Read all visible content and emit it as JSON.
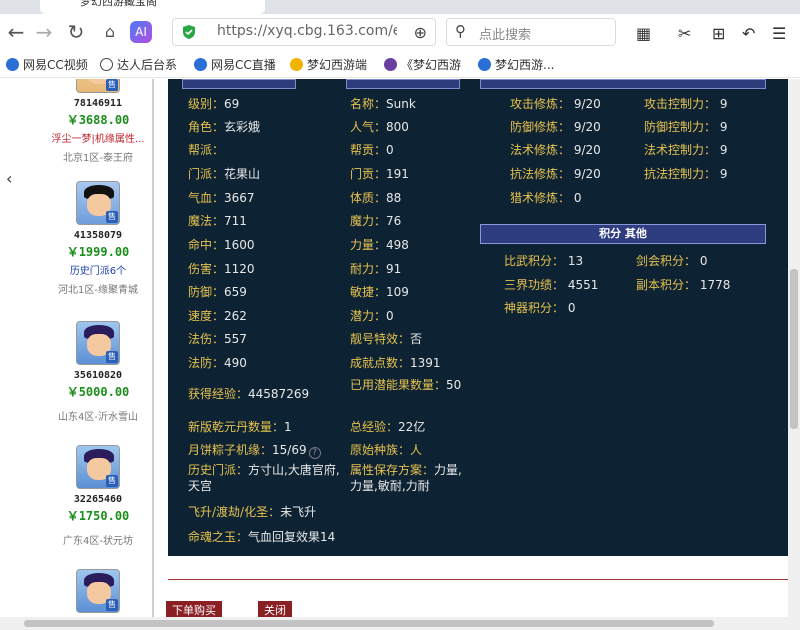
{
  "browser": {
    "tab_title": "梦幻西游藏宝阁",
    "url": "https://xyq.cbg.163.com/ec",
    "search_placeholder": "点此搜索",
    "bookmarks": [
      "网易CC视频",
      "达人后台系",
      "网易CC直播",
      "梦幻西游端",
      "《梦幻西游",
      "梦幻西游..."
    ]
  },
  "listings": [
    {
      "id": "78146911",
      "price": "￥3688.00",
      "note": "浮尘一梦|机缘属性...",
      "note2": "",
      "server": "北京1区-泰王府"
    },
    {
      "id": "41358079",
      "price": "￥1999.00",
      "note": "历史门派6个",
      "server": "河北1区-缘聚青城"
    },
    {
      "id": "35610820",
      "price": "￥5000.00",
      "note": "",
      "server": "山东4区-沂水雪山"
    },
    {
      "id": "32265460",
      "price": "￥1750.00",
      "note": "",
      "server": "广东4区-状元坊"
    }
  ],
  "avatar_tag": "售",
  "attrs": {
    "level_k": "级别：",
    "level_v": "69",
    "name_k": "名称：",
    "name_v": "Sunk",
    "role_k": "角色：",
    "role_v": "玄彩娥",
    "pop_k": "人气：",
    "pop_v": "800",
    "gang_k": "帮派：",
    "gang_v": "",
    "contrib_k": "帮贡：",
    "contrib_v": "0",
    "school_k": "门派：",
    "school_v": "花果山",
    "mcontrib_k": "门贡：",
    "mcontrib_v": "191",
    "hp_k": "气血：",
    "hp_v": "3667",
    "con_k": "体质：",
    "con_v": "88",
    "mp_k": "魔法：",
    "mp_v": "711",
    "mag_k": "魔力：",
    "mag_v": "76",
    "hit_k": "命中：",
    "hit_v": "1600",
    "str_k": "力量：",
    "str_v": "498",
    "dmg_k": "伤害：",
    "dmg_v": "1120",
    "end_k": "耐力：",
    "end_v": "91",
    "def_k": "防御：",
    "def_v": "659",
    "agi_k": "敏捷：",
    "agi_v": "109",
    "spd_k": "速度：",
    "spd_v": "262",
    "pot_k": "潜力：",
    "pot_v": "0",
    "matk_k": "法伤：",
    "matk_v": "557",
    "title_k": "靓号特效：",
    "title_v": "否",
    "mdef_k": "法防：",
    "mdef_v": "490",
    "ach_k": "成就点数：",
    "ach_v": "1391",
    "exp_k": "获得经验：",
    "exp_v": "44587269",
    "fruit_k": "已用潜能果数量：",
    "fruit_v": "50",
    "qk_k": "新版乾元丹数量：",
    "qk_v": "1",
    "total_k": "总经验：",
    "total_v": "22亿",
    "moon_k": "月饼粽子机缘：",
    "moon_v": "15/69",
    "race_k": "原始种族：",
    "race_v": "人",
    "hist_k": "历史门派：",
    "hist_v": "方寸山,大唐官府,天宫",
    "save_k": "属性保存方案：",
    "save_v": "力量,力量,敏耐,力耐",
    "fly_k": "飞升/渡劫/化圣：",
    "fly_v": "未飞升",
    "soul_k": "命魂之玉：",
    "soul_v": "气血回复效果14"
  },
  "cultivation": {
    "atk_k": "攻击修炼：",
    "atk_v": "9/20",
    "atkc_k": "攻击控制力：",
    "atkc_v": "9",
    "def_k": "防御修炼：",
    "def_v": "9/20",
    "defc_k": "防御控制力：",
    "defc_v": "9",
    "mag_k": "法术修炼：",
    "mag_v": "9/20",
    "magc_k": "法术控制力：",
    "magc_v": "9",
    "res_k": "抗法修炼：",
    "res_v": "9/20",
    "resc_k": "抗法控制力：",
    "resc_v": "9",
    "beast_k": "猎术修炼：",
    "beast_v": "0"
  },
  "points": {
    "header": "积分 其他",
    "pk_k": "比武积分：",
    "pk_v": "13",
    "sword_k": "剑会积分：",
    "sword_v": "0",
    "three_k": "三界功绩：",
    "three_v": "4551",
    "dungeon_k": "副本积分：",
    "dungeon_v": "1778",
    "artifact_k": "神器积分：",
    "artifact_v": "0"
  },
  "actions": {
    "buy": "下单购买",
    "close": "关闭"
  }
}
